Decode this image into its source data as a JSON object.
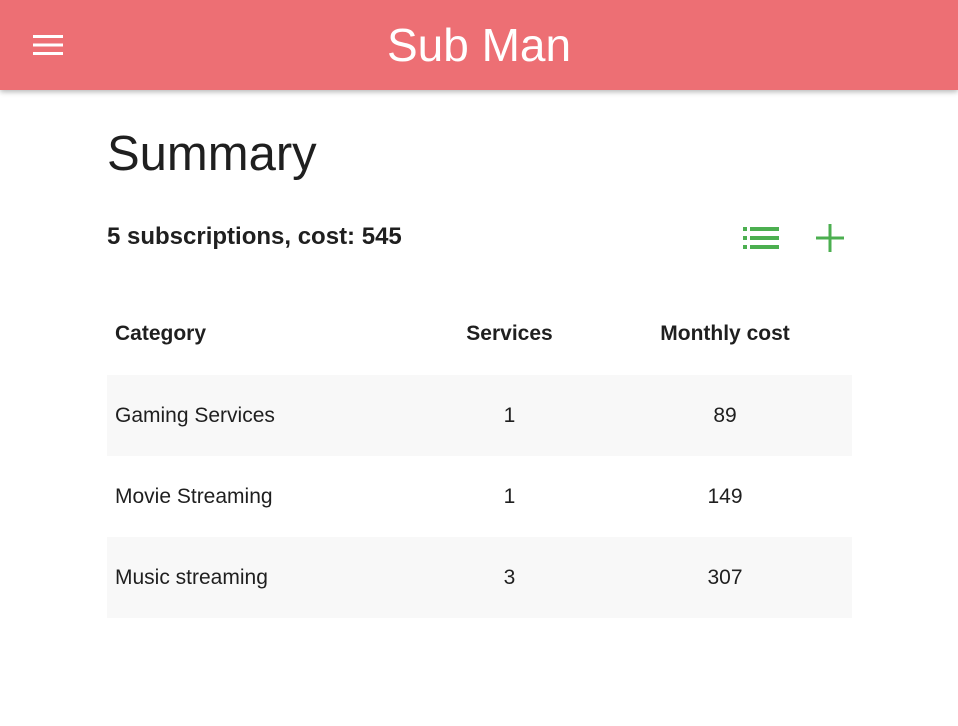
{
  "app": {
    "title": "Sub Man",
    "accent_color": "#ed6f74",
    "action_color": "#4caf50"
  },
  "header": {
    "menu_icon": "hamburger-menu-icon"
  },
  "summary": {
    "page_title": "Summary",
    "count_and_cost": "5 subscriptions, cost: 545",
    "actions": [
      {
        "name": "list-view",
        "icon": "list-icon"
      },
      {
        "name": "add",
        "icon": "plus-icon"
      }
    ]
  },
  "table": {
    "columns": [
      "Category",
      "Services",
      "Monthly cost"
    ],
    "rows": [
      {
        "category": "Gaming Services",
        "services": "1",
        "monthly_cost": "89"
      },
      {
        "category": "Movie Streaming",
        "services": "1",
        "monthly_cost": "149"
      },
      {
        "category": "Music streaming",
        "services": "3",
        "monthly_cost": "307"
      }
    ]
  }
}
